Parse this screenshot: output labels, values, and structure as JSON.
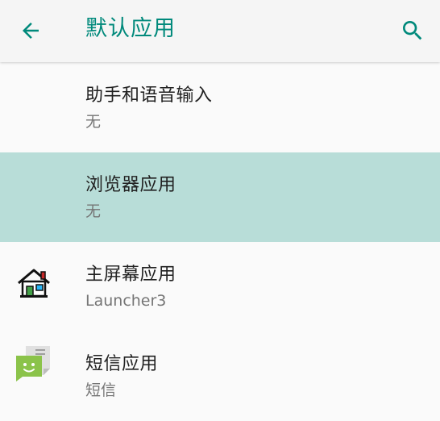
{
  "header": {
    "title": "默认应用",
    "back_icon": "arrow-back-icon",
    "search_icon": "search-icon"
  },
  "colors": {
    "accent": "#00897b",
    "selected_row": "#b8ddd8",
    "background": "#fafafa"
  },
  "items": [
    {
      "title": "助手和语音输入",
      "subtitle": "无",
      "icon": "none"
    },
    {
      "title": "浏览器应用",
      "subtitle": "无",
      "icon": "none",
      "selected": true
    },
    {
      "title": "主屏幕应用",
      "subtitle": "Launcher3",
      "icon": "house-icon"
    },
    {
      "title": "短信应用",
      "subtitle": "短信",
      "icon": "messaging-app-icon"
    }
  ]
}
